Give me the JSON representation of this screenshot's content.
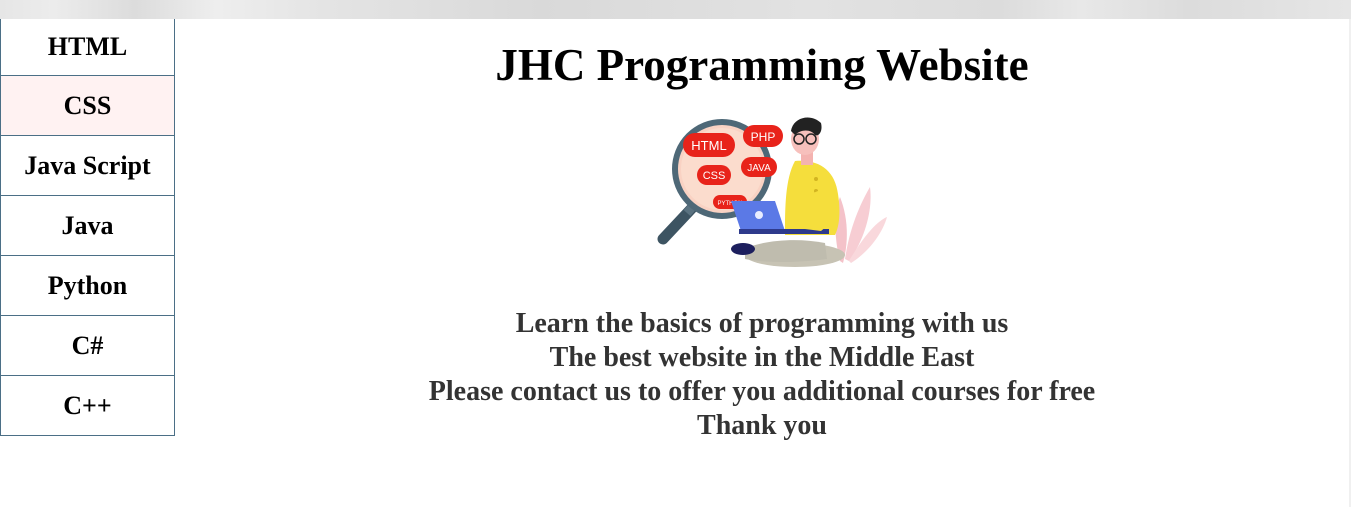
{
  "sidebar": {
    "items": [
      {
        "label": "HTML"
      },
      {
        "label": "CSS"
      },
      {
        "label": "Java Script"
      },
      {
        "label": "Java"
      },
      {
        "label": "Python"
      },
      {
        "label": "C#"
      },
      {
        "label": "C++"
      }
    ]
  },
  "main": {
    "title": "JHC Programming Website",
    "illustration": {
      "bubbles": [
        "HTML",
        "PHP",
        "CSS",
        "JAVA",
        "PYTHON"
      ]
    },
    "lines": [
      "Learn the basics of programming with us",
      "The best website in the Middle East",
      "Please contact us to offer you additional courses for free",
      "Thank you"
    ]
  },
  "colors": {
    "nav_border": "#4b6f86",
    "nav_hover_bg": "#fff2f2",
    "bubble_red": "#e8231a",
    "laptop_blue": "#5b79e6",
    "shirt_yellow": "#f5de3c"
  }
}
